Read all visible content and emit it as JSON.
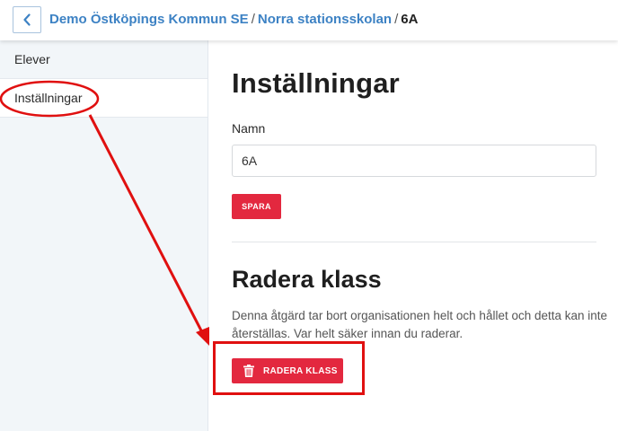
{
  "header": {
    "breadcrumb": [
      {
        "label": "Demo Östköpings Kommun SE"
      },
      {
        "label": "Norra stationsskolan"
      }
    ],
    "separator": "/",
    "current": "6A"
  },
  "sidebar": {
    "items": [
      {
        "label": "Elever",
        "active": false
      },
      {
        "label": "Inställningar",
        "active": true
      }
    ]
  },
  "settings": {
    "title": "Inställningar",
    "name_label": "Namn",
    "name_value": "6A",
    "save_label": "SPARA"
  },
  "delete_section": {
    "title": "Radera klass",
    "description": "Denna åtgärd tar bort organisationen helt och hållet och detta kan inte återställas. Var helt säker innan du raderar.",
    "button_label": "RADERA KLASS",
    "button_icon": "trash-icon"
  },
  "colors": {
    "accent_red": "#e3283f",
    "link_blue": "#3d82c4",
    "sidebar_bg": "#f2f6f9",
    "annotation_red": "#e01010"
  }
}
